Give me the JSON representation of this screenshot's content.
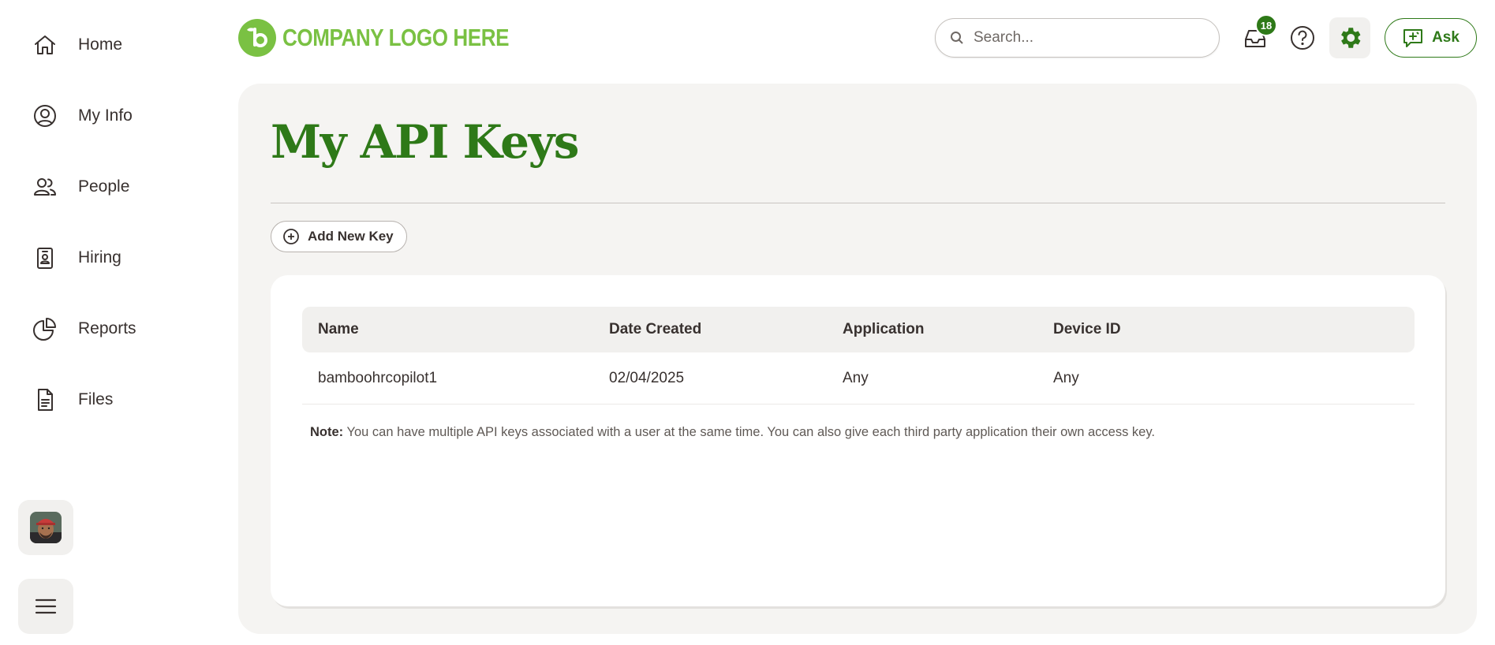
{
  "nav": {
    "items": [
      {
        "label": "Home",
        "icon": "home-icon"
      },
      {
        "label": "My Info",
        "icon": "user-circle-icon"
      },
      {
        "label": "People",
        "icon": "people-icon"
      },
      {
        "label": "Hiring",
        "icon": "id-badge-icon"
      },
      {
        "label": "Reports",
        "icon": "pie-chart-icon"
      },
      {
        "label": "Files",
        "icon": "document-icon"
      }
    ]
  },
  "header": {
    "logo_text": "COMPANY LOGO HERE",
    "search_placeholder": "Search...",
    "inbox_badge": "18",
    "ask_label": "Ask",
    "brand_color": "#7ac143",
    "accent_color": "#2e7918"
  },
  "page": {
    "title": "My API Keys",
    "add_key_label": "Add New Key"
  },
  "table": {
    "columns": [
      "Name",
      "Date Created",
      "Application",
      "Device ID"
    ],
    "rows": [
      [
        "bamboohrcopilot1",
        "02/04/2025",
        "Any",
        "Any"
      ]
    ]
  },
  "note": {
    "label": "Note:",
    "text": " You can have multiple API keys associated with a user at the same time. You can also give each third party application their own access key."
  }
}
